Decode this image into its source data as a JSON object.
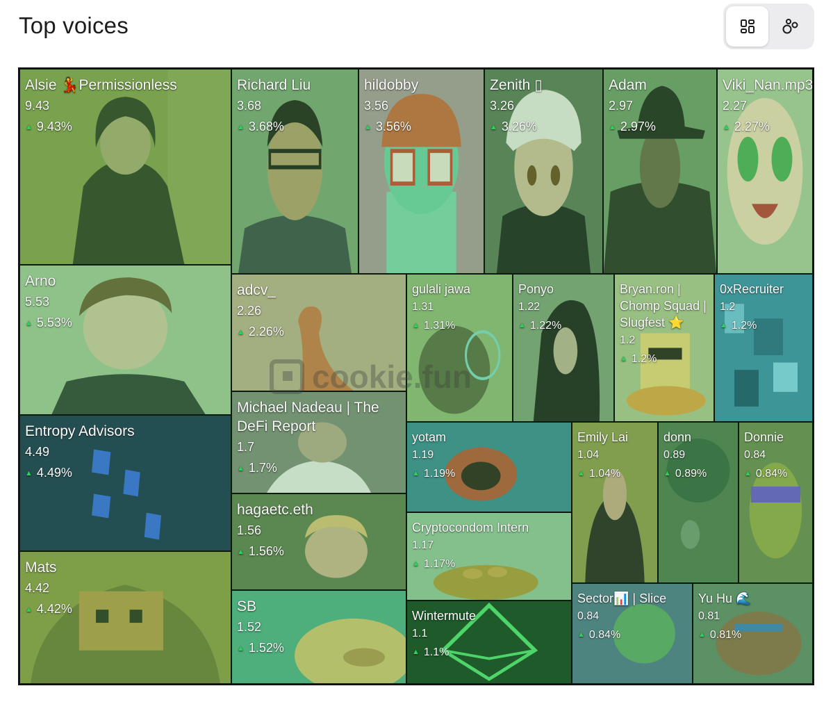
{
  "header": {
    "title": "Top voices"
  },
  "view_toggle": {
    "grid_icon": "grid-view-icon",
    "bubble_icon": "bubble-view-icon",
    "active": "grid"
  },
  "watermark": {
    "text": "cookie.fun"
  },
  "tiles": [
    {
      "name": "Alsie 💃Permissionless",
      "score": "9.43",
      "change": "9.43%"
    },
    {
      "name": "Richard Liu",
      "score": "3.68",
      "change": "3.68%"
    },
    {
      "name": "hildobby",
      "score": "3.56",
      "change": "3.56%"
    },
    {
      "name": "Zenith ▯",
      "score": "3.26",
      "change": "3.26%"
    },
    {
      "name": "Adam",
      "score": "2.97",
      "change": "2.97%"
    },
    {
      "name": "Viki_Nan.mp3",
      "score": "2.27",
      "change": "2.27%"
    },
    {
      "name": "Arno",
      "score": "5.53",
      "change": "5.53%"
    },
    {
      "name": "adcv_",
      "score": "2.26",
      "change": "2.26%"
    },
    {
      "name": "gulali jawa",
      "score": "1.31",
      "change": "1.31%"
    },
    {
      "name": "Ponyo",
      "score": "1.22",
      "change": "1.22%"
    },
    {
      "name": "Bryan.ron | Chomp Squad | Slugfest ⭐",
      "score": "1.2",
      "change": "1.2%"
    },
    {
      "name": "0xRecruiter",
      "score": "1.2",
      "change": "1.2%"
    },
    {
      "name": "Entropy Advisors",
      "score": "4.49",
      "change": "4.49%"
    },
    {
      "name": "Michael Nadeau | The DeFi Report",
      "score": "1.7",
      "change": "1.7%"
    },
    {
      "name": "yotam",
      "score": "1.19",
      "change": "1.19%"
    },
    {
      "name": "Emily Lai",
      "score": "1.04",
      "change": "1.04%"
    },
    {
      "name": "donn",
      "score": "0.89",
      "change": "0.89%"
    },
    {
      "name": "Donnie",
      "score": "0.84",
      "change": "0.84%"
    },
    {
      "name": "hagaetc.eth",
      "score": "1.56",
      "change": "1.56%"
    },
    {
      "name": "Cryptocondom Intern",
      "score": "1.17",
      "change": "1.17%"
    },
    {
      "name": "Mats",
      "score": "4.42",
      "change": "4.42%"
    },
    {
      "name": "SB",
      "score": "1.52",
      "change": "1.52%"
    },
    {
      "name": "Wintermute",
      "score": "1.1",
      "change": "1.1%"
    },
    {
      "name": "Sector📊 | Slice",
      "score": "0.84",
      "change": "0.84%"
    },
    {
      "name": "Yu Hu 🌊",
      "score": "0.81",
      "change": "0.81%"
    }
  ],
  "colors": {
    "tile_overlay": "#4caf50",
    "up_arrow": "#2fd15a",
    "border": "#111111"
  }
}
